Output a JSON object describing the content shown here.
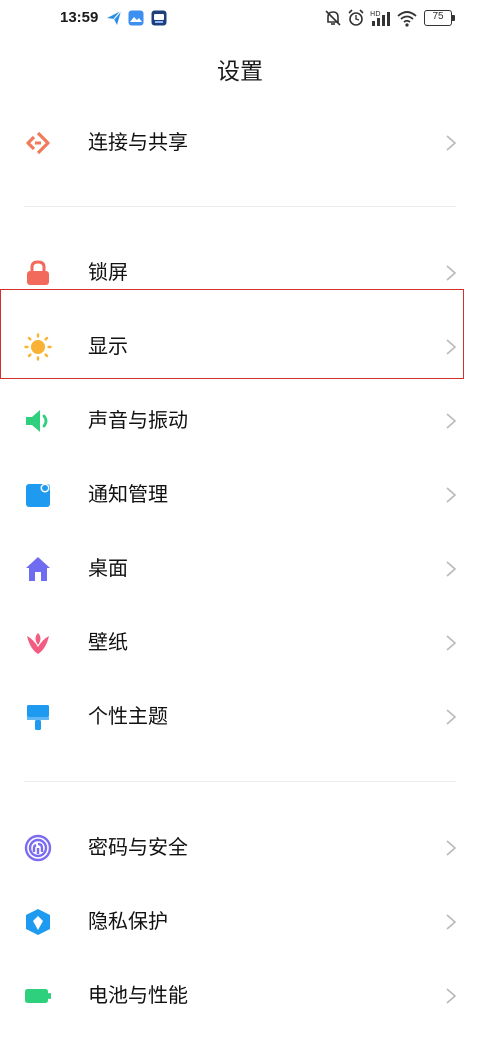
{
  "status_bar": {
    "time": "13:59",
    "battery": "75"
  },
  "header": {
    "title": "设置"
  },
  "settings": {
    "items": [
      {
        "label": "连接与共享",
        "icon": "share-icon",
        "color": "#f07a5a"
      },
      {
        "label": "锁屏",
        "icon": "lock-icon",
        "color": "#f26a5b"
      },
      {
        "label": "显示",
        "icon": "sun-icon",
        "color": "#f9b233"
      },
      {
        "label": "声音与振动",
        "icon": "speaker-icon",
        "color": "#2fd07d"
      },
      {
        "label": "通知管理",
        "icon": "notification-icon",
        "color": "#1e9bf0"
      },
      {
        "label": "桌面",
        "icon": "home-icon",
        "color": "#6f6cf2"
      },
      {
        "label": "壁纸",
        "icon": "flower-icon",
        "color": "#f25c83"
      },
      {
        "label": "个性主题",
        "icon": "brush-icon",
        "color": "#1e9bf0"
      },
      {
        "label": "密码与安全",
        "icon": "fingerprint-icon",
        "color": "#7b6cf2"
      },
      {
        "label": "隐私保护",
        "icon": "privacy-shield-icon",
        "color": "#1e9bf0"
      },
      {
        "label": "电池与性能",
        "icon": "battery-icon",
        "color": "#2fd07d"
      }
    ]
  }
}
